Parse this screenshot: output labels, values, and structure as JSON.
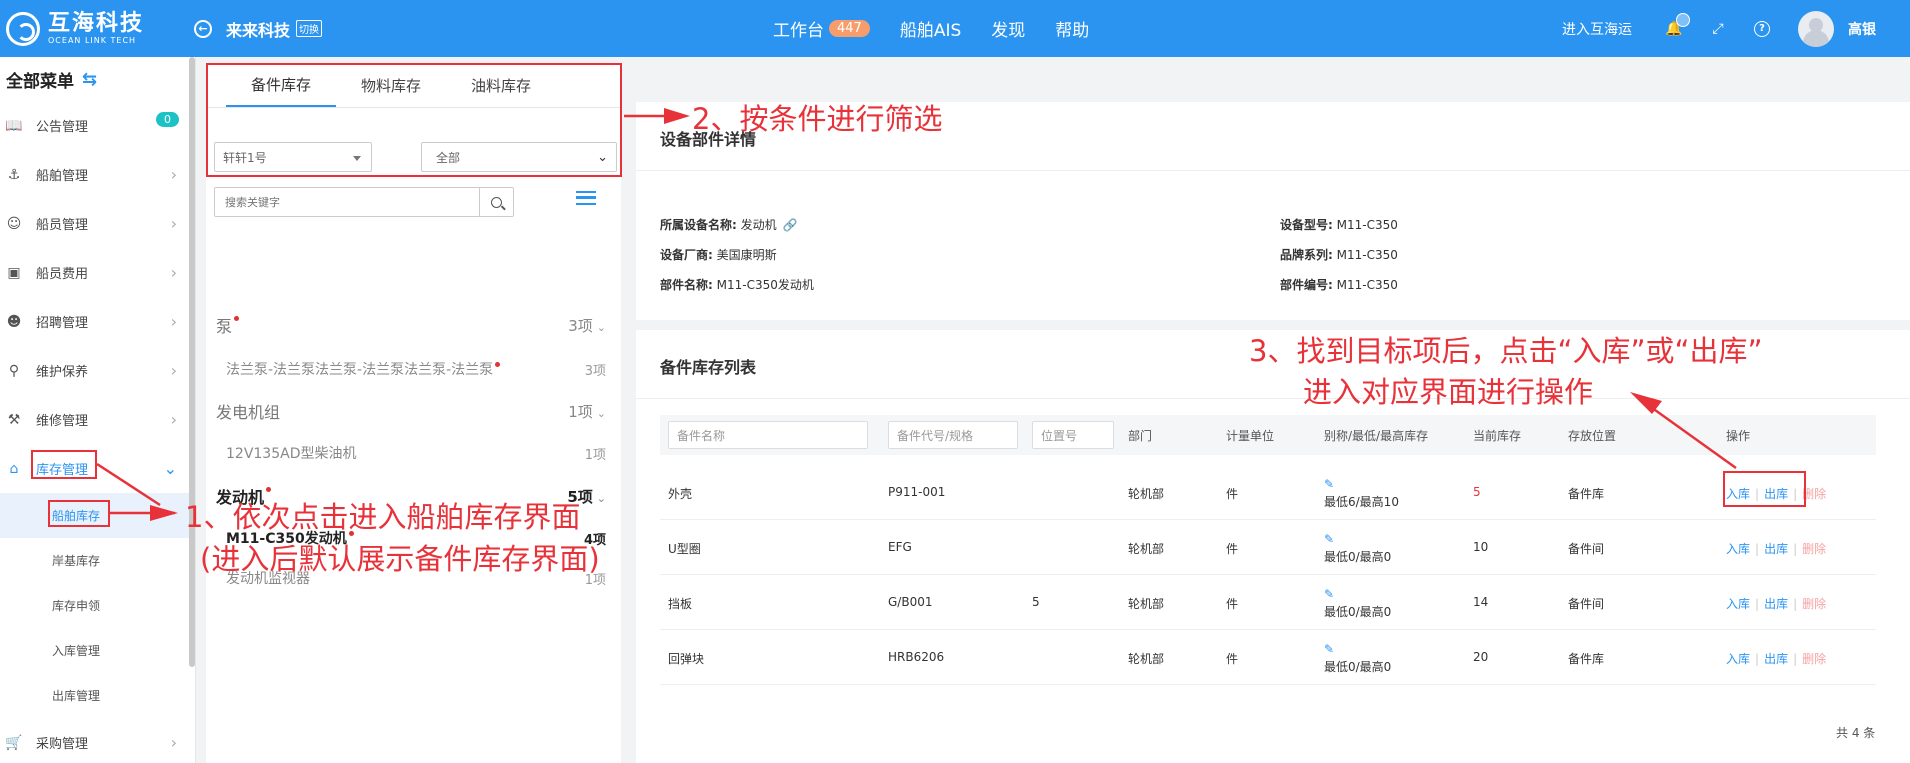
{
  "header": {
    "logo_cn": "互海科技",
    "logo_en": "OCEAN LINK TECH",
    "org": "来来科技",
    "switch": "切换",
    "nav": [
      {
        "label": "工作台",
        "badge": "447"
      },
      {
        "label": "船舶AIS"
      },
      {
        "label": "发现"
      },
      {
        "label": "帮助"
      }
    ],
    "enter_link": "进入互海运",
    "user": "高银"
  },
  "sidebar": {
    "title": "全部菜单",
    "items": [
      {
        "label": "公告管理",
        "icon": "book-icon",
        "badge": "0"
      },
      {
        "label": "船舶管理",
        "icon": "anchor-icon"
      },
      {
        "label": "船员管理",
        "icon": "user-icon"
      },
      {
        "label": "船员费用",
        "icon": "wallet-icon"
      },
      {
        "label": "招聘管理",
        "icon": "recruit-icon"
      },
      {
        "label": "维护保养",
        "icon": "maintenance-icon"
      },
      {
        "label": "维修管理",
        "icon": "wrench-icon"
      },
      {
        "label": "库存管理",
        "icon": "home-icon"
      }
    ],
    "subitems": [
      "船舶库存",
      "岸基库存",
      "库存申领",
      "入库管理",
      "出库管理"
    ],
    "bottom_item": {
      "label": "采购管理",
      "icon": "cart-icon"
    }
  },
  "middle": {
    "tabs": [
      "备件库存",
      "物料库存",
      "油料库存"
    ],
    "ship_select": "轩轩1号",
    "dept_select": "全部",
    "search_placeholder": "搜索关键字",
    "tree": [
      {
        "name": "泵",
        "count": "3项",
        "level": "group",
        "dot": true
      },
      {
        "name": "法兰泵-法兰泵法兰泵-法兰泵法兰泵-法兰泵",
        "count": "3项",
        "level": "child",
        "dot": true
      },
      {
        "name": "发电机组",
        "count": "1项",
        "level": "group",
        "dot": false
      },
      {
        "name": "12V135AD型柴油机",
        "count": "1项",
        "level": "child",
        "dot": false
      },
      {
        "name": "发动机",
        "count": "5项",
        "level": "group",
        "dot": true,
        "bold": true
      },
      {
        "name": "M11-C350发动机",
        "count": "4项",
        "level": "child",
        "dot": true,
        "bold": true
      },
      {
        "name": "发动机监视器",
        "count": "1项",
        "level": "child",
        "dot": false
      }
    ]
  },
  "detail": {
    "title": "设备部件详情",
    "fields": [
      {
        "k": "所属设备名称:",
        "v": "发动机"
      },
      {
        "k": "设备型号:",
        "v": "M11-C350"
      },
      {
        "k": "设备厂商:",
        "v": "美国康明斯"
      },
      {
        "k": "品牌系列:",
        "v": "M11-C350"
      },
      {
        "k": "部件名称:",
        "v": "M11-C350发动机"
      },
      {
        "k": "部件编号:",
        "v": "M11-C350"
      }
    ]
  },
  "inventory": {
    "title": "备件库存列表",
    "filters": [
      "备件名称",
      "备件代号/规格",
      "位置号"
    ],
    "headers": [
      "部门",
      "计量单位",
      "别称/最低/最高库存",
      "当前库存",
      "存放位置",
      "操作"
    ],
    "rows": [
      {
        "name": "外壳",
        "code": "P911-001",
        "pos": "",
        "dept": "轮机部",
        "unit": "件",
        "minmax": "最低6/最高10",
        "stock": "5",
        "low": true,
        "loc": "备件库"
      },
      {
        "name": "U型圈",
        "code": "EFG",
        "pos": "",
        "dept": "轮机部",
        "unit": "件",
        "minmax": "最低0/最高0",
        "stock": "10",
        "low": false,
        "loc": "备件间"
      },
      {
        "name": "挡板",
        "code": "G/B001",
        "pos": "5",
        "dept": "轮机部",
        "unit": "件",
        "minmax": "最低0/最高0",
        "stock": "14",
        "low": false,
        "loc": "备件间"
      },
      {
        "name": "回弹块",
        "code": "HRB6206",
        "pos": "",
        "dept": "轮机部",
        "unit": "件",
        "minmax": "最低0/最高0",
        "stock": "20",
        "low": false,
        "loc": "备件库"
      }
    ],
    "ops": {
      "in": "入库",
      "out": "出库",
      "del": "删除"
    },
    "total": "共 4 条"
  },
  "annotations": {
    "step1_line1": "1、依次点击进入船舶库存界面",
    "step1_line2": "(进入后默认展示备件库存界面)",
    "step2": "2、按条件进行筛选",
    "step3_line1": "3、找到目标项后，点击“入库”或“出库”",
    "step3_line2": "进入对应界面进行操作",
    "color": "#e8323a"
  },
  "colors": {
    "primary": "#2b94f0",
    "badge": "#f79d6b",
    "danger": "#e8323a"
  }
}
